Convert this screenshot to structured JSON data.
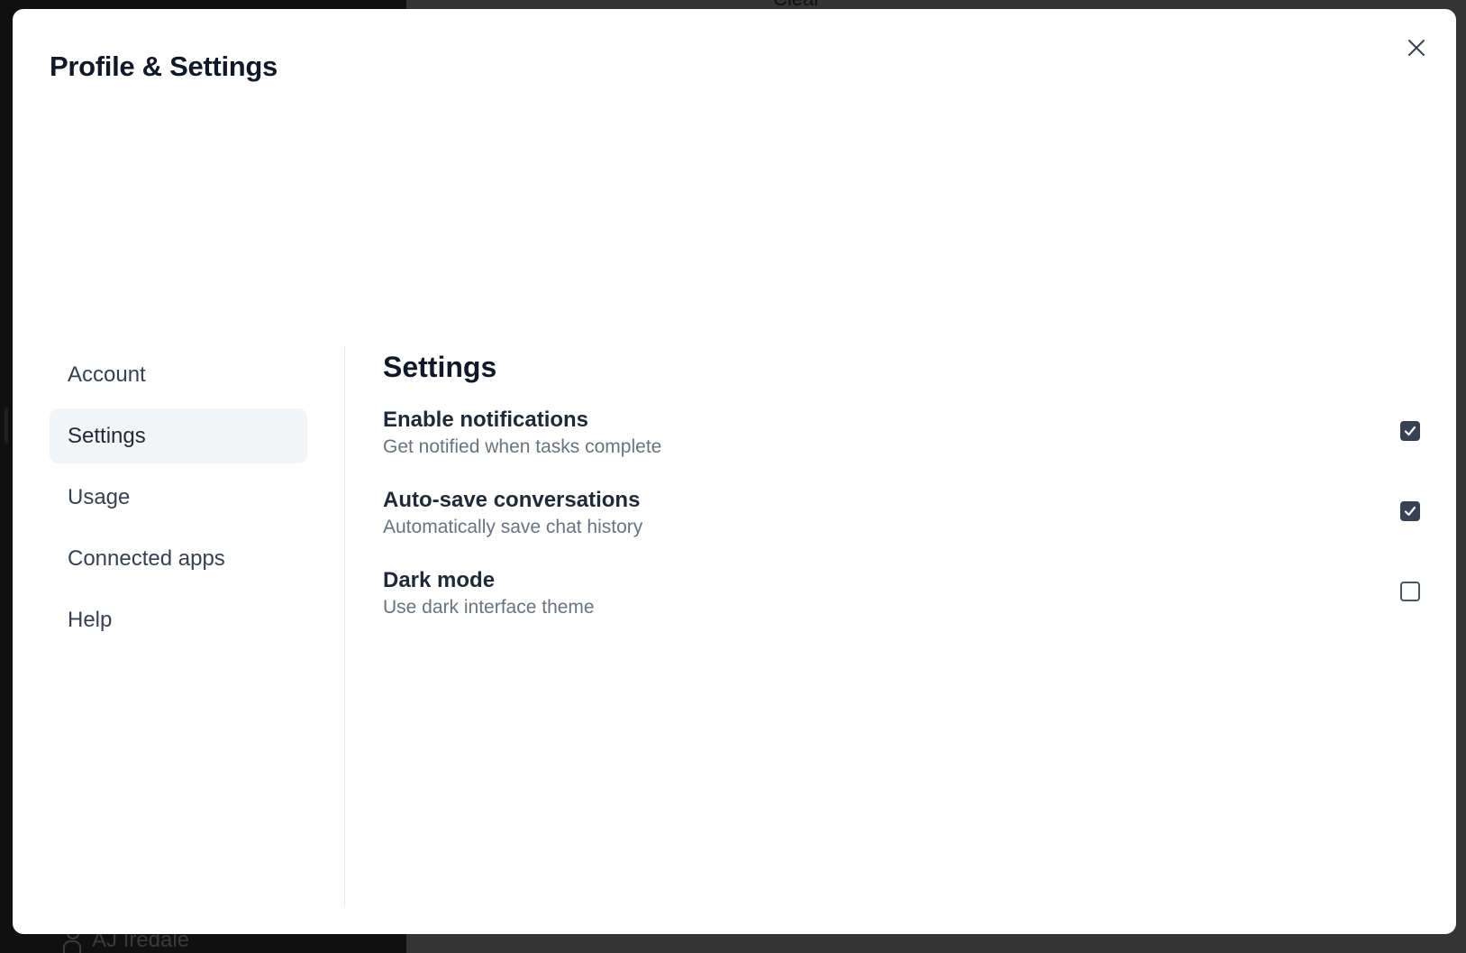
{
  "background": {
    "top_text": "Clear",
    "user_name": "AJ Iredale"
  },
  "modal": {
    "title": "Profile & Settings",
    "close_icon": "close-icon"
  },
  "nav": {
    "items": [
      {
        "label": "Account",
        "active": false
      },
      {
        "label": "Settings",
        "active": true
      },
      {
        "label": "Usage",
        "active": false
      },
      {
        "label": "Connected apps",
        "active": false
      },
      {
        "label": "Help",
        "active": false
      }
    ]
  },
  "content": {
    "title": "Settings",
    "settings": [
      {
        "label": "Enable notifications",
        "description": "Get notified when tasks complete",
        "checked": true
      },
      {
        "label": "Auto-save conversations",
        "description": "Automatically save chat history",
        "checked": true
      },
      {
        "label": "Dark mode",
        "description": "Use dark interface theme",
        "checked": false
      }
    ]
  },
  "colors": {
    "checkbox_checked": "#374151",
    "active_nav_bg": "#f3f4f6"
  }
}
